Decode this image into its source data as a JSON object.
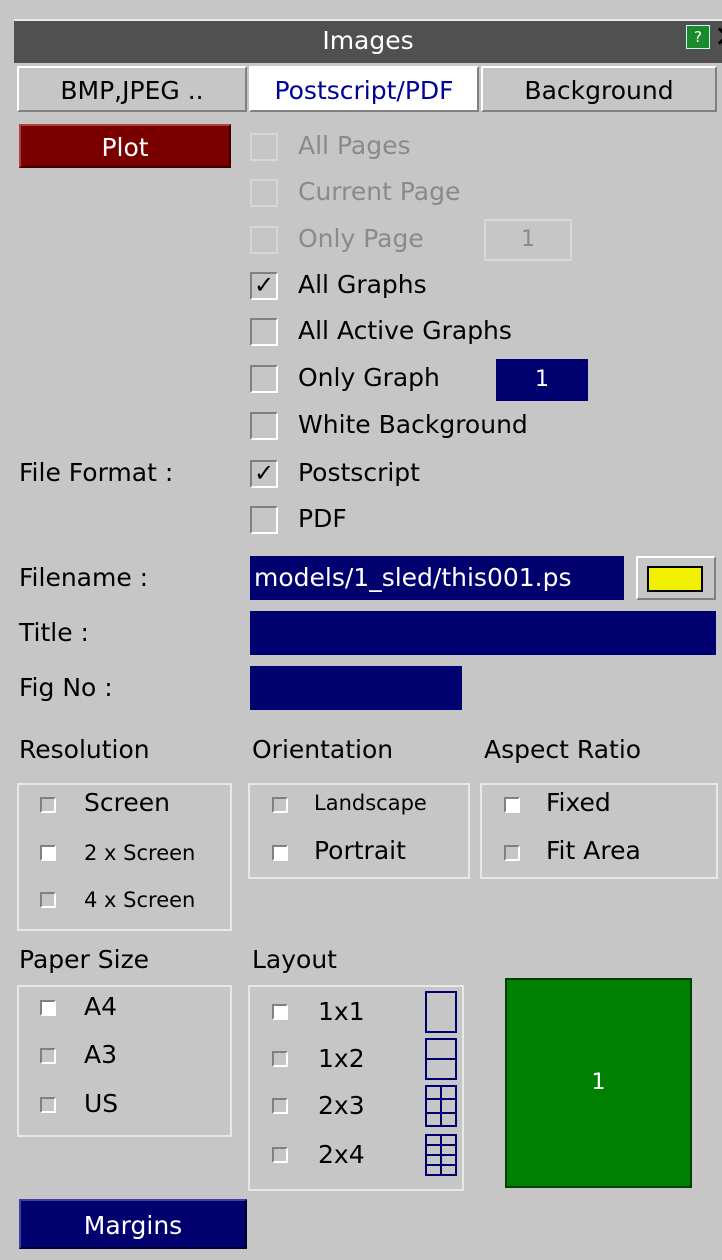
{
  "window": {
    "title": "Images",
    "help_label": "?",
    "close_label": "✕"
  },
  "tabs": [
    {
      "label": "BMP,JPEG .."
    },
    {
      "label": "Postscript/PDF"
    },
    {
      "label": "Background"
    }
  ],
  "plot_label": "Plot",
  "options": {
    "all_pages": "All Pages",
    "current_page": "Current Page",
    "only_page": "Only Page",
    "only_page_value": "1",
    "all_graphs": "All Graphs",
    "all_active_graphs": "All Active Graphs",
    "only_graph": "Only Graph",
    "only_graph_value": "1",
    "white_background": "White Background"
  },
  "file_format": {
    "label": "File Format :",
    "postscript": "Postscript",
    "pdf": "PDF"
  },
  "filename": {
    "label": "Filename :",
    "value": "models/1_sled/this001.ps"
  },
  "title": {
    "label": "Title :",
    "value": ""
  },
  "fig_no": {
    "label": "Fig No :",
    "value": ""
  },
  "resolution": {
    "heading": "Resolution",
    "screen": "Screen",
    "two_x": "2 x Screen",
    "four_x": "4 x Screen"
  },
  "orientation": {
    "heading": "Orientation",
    "landscape": "Landscape",
    "portrait": "Portrait"
  },
  "aspect_ratio": {
    "heading": "Aspect Ratio",
    "fixed": "Fixed",
    "fit_area": "Fit Area"
  },
  "paper_size": {
    "heading": "Paper Size",
    "a4": "A4",
    "a3": "A3",
    "us": "US"
  },
  "layout": {
    "heading": "Layout",
    "l1": "1x1",
    "l2": "1x2",
    "l3": "2x3",
    "l4": "2x4"
  },
  "preview_label": "1",
  "margins_label": "Margins",
  "colors": {
    "navy": "#00006e",
    "plot_red": "#7a0000",
    "preview_green": "#008000",
    "folder_yellow": "#f0f000"
  }
}
